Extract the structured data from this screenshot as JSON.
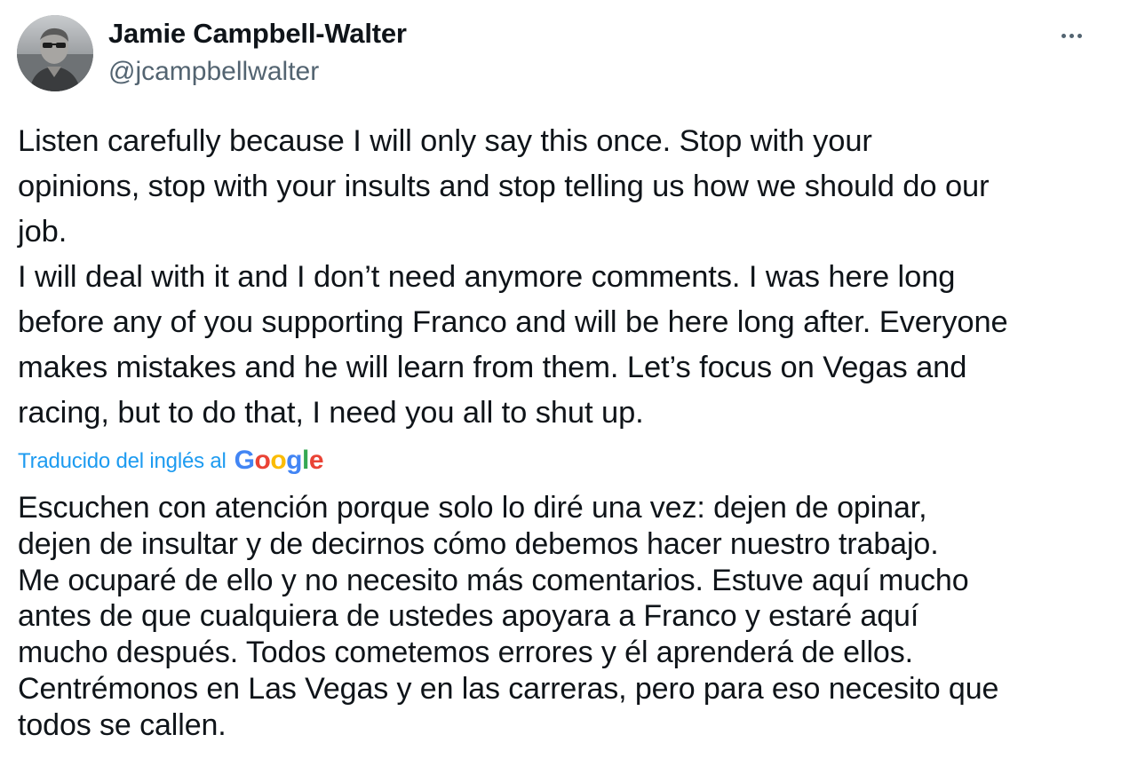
{
  "author": {
    "name": "Jamie Campbell-Walter",
    "handle": "@jcampbellwalter"
  },
  "menu": {
    "more_icon": "more-horizontal-icon"
  },
  "tweet": {
    "original_lines": [
      "Listen carefully because I will only say this once. Stop with your",
      "opinions, stop with your insults and stop telling us how we should do our",
      "job.",
      "I will deal with it and I don’t need anymore comments. I was here long",
      "before any of you supporting Franco and will be here long after. Everyone",
      "makes mistakes and he will learn from them. Let’s focus on Vegas and",
      "racing, but to do that, I need you all to shut up."
    ],
    "translation_label": "Traducido del inglés al",
    "translation_provider": "Google",
    "translated_lines": [
      "Escuchen con atención porque solo lo diré una vez: dejen de opinar,",
      "dejen de insultar y de decirnos cómo debemos hacer nuestro trabajo.",
      "Me ocuparé de ello y no necesito más comentarios. Estuve aquí mucho",
      "antes de que cualquiera de ustedes apoyara a Franco y estaré aquí",
      "mucho después. Todos cometemos errores y él aprenderá de ellos.",
      "Centrémonos en Las Vegas y en las carreras, pero para eso necesito que",
      "todos se callen."
    ]
  },
  "colors": {
    "text": "#0f1419",
    "secondary": "#536471",
    "link": "#1d9bf0",
    "google_blue": "#4285f4",
    "google_red": "#ea4335",
    "google_yellow": "#fbbc05",
    "google_green": "#34a853"
  }
}
